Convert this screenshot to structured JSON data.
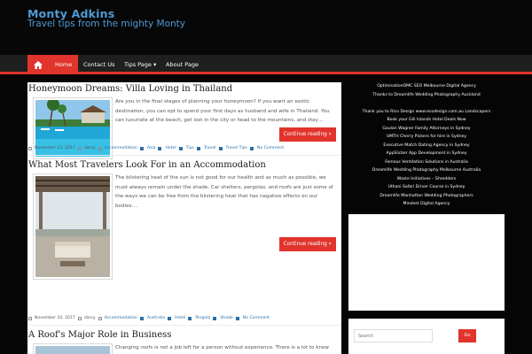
{
  "site": {
    "title": "Monty Adkins",
    "tagline": "Travel tips from the mighty Monty"
  },
  "nav": {
    "home_icon": "home-icon",
    "items": [
      "Home",
      "Contact Us",
      "Tips Page ▾",
      "About Page"
    ]
  },
  "colors": {
    "accent": "#e0342c",
    "brand": "#4f9bd6",
    "tag": "#2a6fa8"
  },
  "posts": [
    {
      "title": "Honeymoon Dreams: Villa Loving in Thailand",
      "excerpt": "Are you in the final stages of planning your honeymoon? If you want an exotic destination, you can opt to spend your first days as husband and wife in Thailand. You can luxuriate at the beach, get lost in the city or head to the mountains, and stay…",
      "more": "Continue reading »",
      "date": "November 13, 2017",
      "author": "darcy",
      "tags": [
        "Accommodation",
        "Asia",
        "Hotel",
        "Tips",
        "Travel",
        "Travel Tips"
      ],
      "comments": "No Comment"
    },
    {
      "title": "What Most Travelers Look For in an Accommodation",
      "excerpt": "The blistering heat of the sun is not good for our health and as much as possible, we must always remain under the shade. Car shelters, pergolas, and roofs are just some of the ways we can be free from the blistering heat that has negative effects on our bodies.…",
      "more": "Continue reading »",
      "date": "November 10, 2017",
      "author": "darcy",
      "tags": [
        "Accommodation",
        "Australia",
        "Hotel",
        "Pergola",
        "Shade"
      ],
      "comments": "No Comment"
    },
    {
      "title": "A Roof's Major Role in Business",
      "excerpt": "Changing roofs is not a job left for a person without experience. There is a lot to know"
    }
  ],
  "sidebar": {
    "links": [
      "OptimisationOMC SEO Melbourne Digital Agency",
      "Thanks to Dreamlife Wedding Photography Auckland",
      "",
      "Thank you to Rico Design www.ecodesign.com.au Landscapers",
      "Book your Gili Islands Hotel Deals Now",
      "Goulan Wagner Family Attorneys in Sydney",
      "UMTH Cherry Pickers for hire in Sydney",
      "Executive Match Dating Agency in Sydney",
      "AppSlicker App Development in Sydney",
      "Famous Ventilation Solutions in Australia",
      "Dreamlife Wedding Photography Melbourne Australia",
      "Waste Initiatives – Shredders",
      "Uthani Safari Driver Course in Sydney",
      "Dreamlife Manhattan Wedding Photographers",
      "Mindest Digital Agency"
    ],
    "search_placeholder": "Search",
    "search_button": "Go"
  }
}
